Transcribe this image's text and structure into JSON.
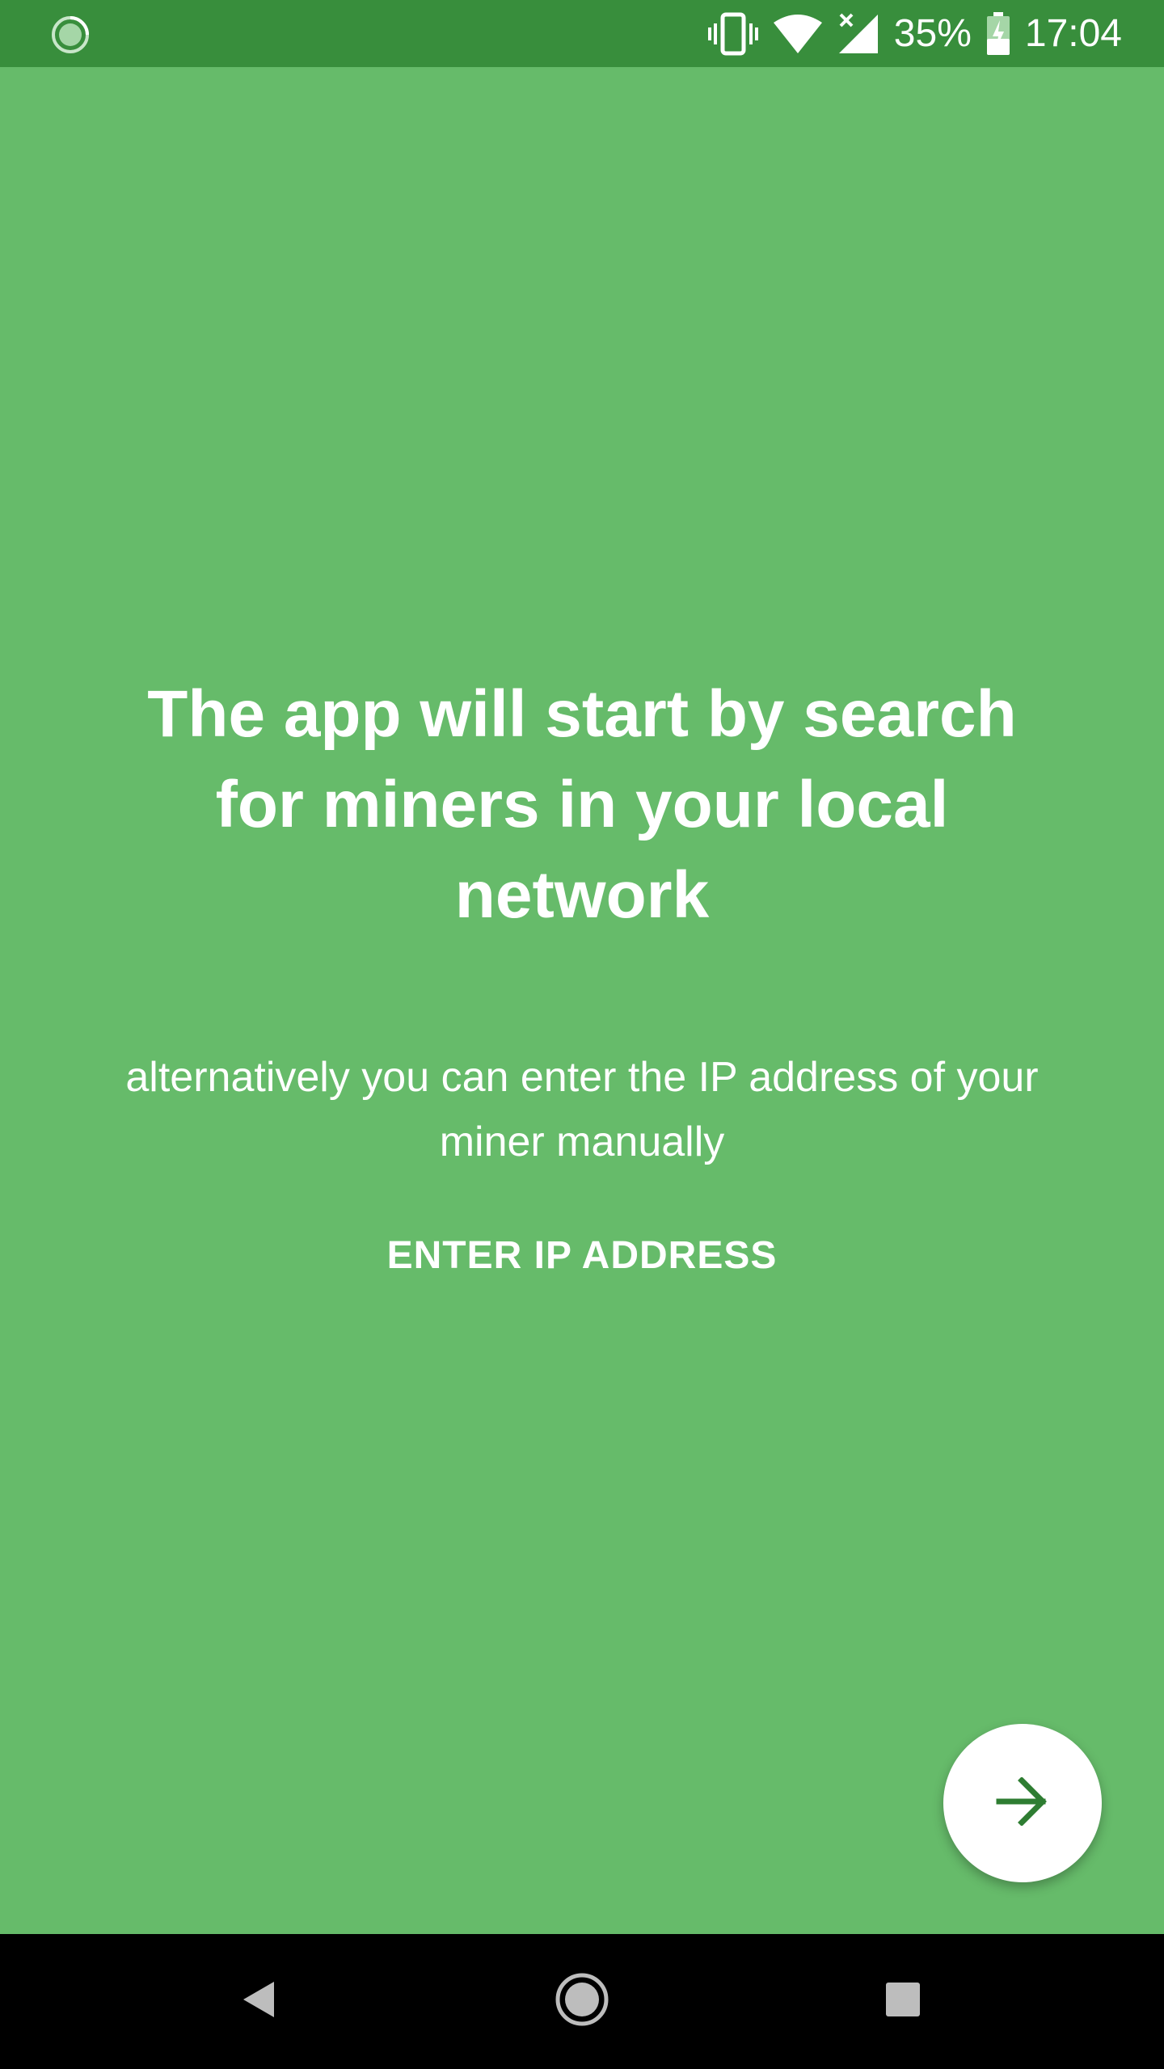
{
  "status_bar": {
    "battery": "35%",
    "time": "17:04",
    "icons": [
      "sync-icon",
      "vibrate-icon",
      "wifi-icon",
      "no-signal-icon",
      "battery-charging-icon"
    ]
  },
  "onboarding": {
    "headline": "The app will start by search for miners in your local network",
    "subtext": "alternatively you can enter the IP address of your miner manually",
    "enter_ip_label": "ENTER IP ADDRESS",
    "next_icon": "arrow-right-icon"
  },
  "nav_bar": {
    "icons": [
      "back-icon",
      "home-icon",
      "recents-icon"
    ]
  },
  "colors": {
    "background": "#66bb6a",
    "status_bar": "#388e3c",
    "fab_icon": "#2e7d32",
    "nav_bar": "#000000"
  }
}
